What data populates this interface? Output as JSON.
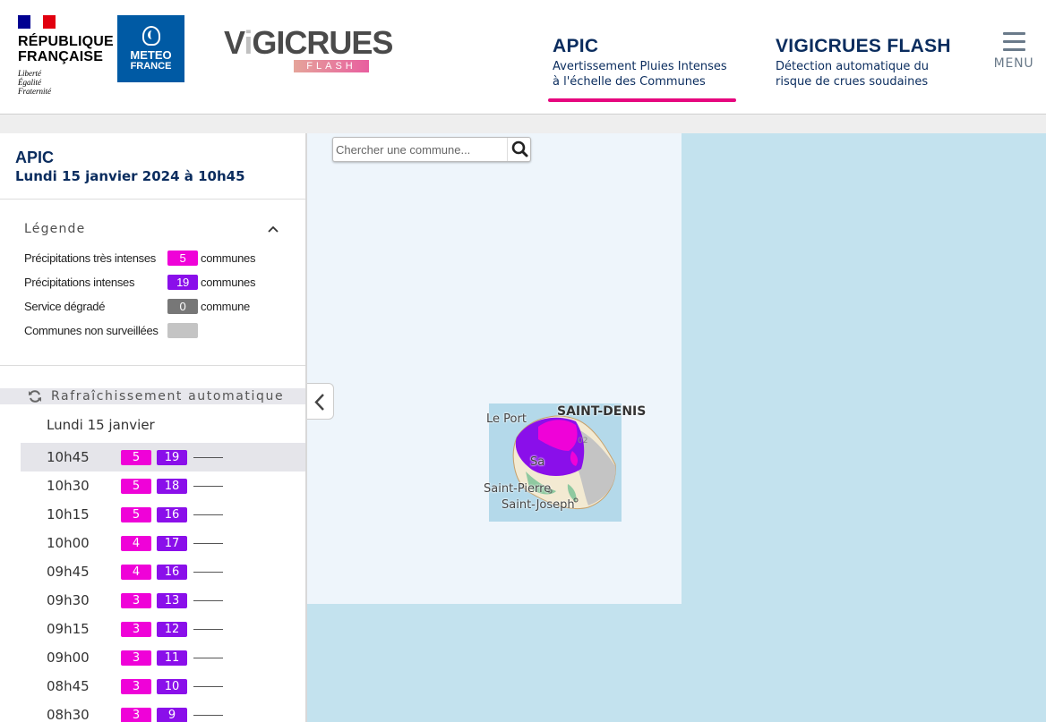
{
  "header": {
    "republique": {
      "title_line1": "RÉPUBLIQUE",
      "title_line2": "FRANÇAISE",
      "motto": [
        "Liberté",
        "Égalité",
        "Fraternité"
      ],
      "flag_colors": [
        "#000091",
        "#ffffff",
        "#e1000f"
      ]
    },
    "meteo_france": {
      "line1": "METEO",
      "line2": "FRANCE",
      "color": "#005aa4"
    },
    "vigicrues": {
      "word_pre": "V",
      "word_i": "i",
      "word_post": "GICRUES",
      "flash": "FLASH"
    },
    "nav": [
      {
        "title": "APIC",
        "subtitle_line1": "Avertissement Pluies Intenses",
        "subtitle_line2": "à l'échelle des Communes",
        "active": true
      },
      {
        "title": "VIGICRUES FLASH",
        "subtitle_line1": "Détection automatique du",
        "subtitle_line2": "risque de crues soudaines",
        "active": false
      }
    ],
    "menu_label": "MENU",
    "accent_color": "#e6077e"
  },
  "sidebar": {
    "title": "APIC",
    "date": "Lundi 15 janvier 2024 à 10h45",
    "legend": {
      "heading": "Légende",
      "rows": [
        {
          "label": "Précipitations très intenses",
          "count": "5",
          "unit": "communes",
          "color": "#ef02d8"
        },
        {
          "label": "Précipitations intenses",
          "count": "19",
          "unit": "communes",
          "color": "#8a0fea"
        },
        {
          "label": "Service dégradé",
          "count": "0",
          "unit": "commune",
          "color": "#777777"
        },
        {
          "label": "Communes non surveillées",
          "count": "",
          "unit": "",
          "color": "#c4c4c4"
        }
      ]
    },
    "refresh_label": "Rafraîchissement automatique",
    "day_label": "Lundi 15 janvier",
    "timeline": [
      {
        "time": "10h45",
        "very_intense": "5",
        "intense": "19",
        "active": true
      },
      {
        "time": "10h30",
        "very_intense": "5",
        "intense": "18"
      },
      {
        "time": "10h15",
        "very_intense": "5",
        "intense": "16"
      },
      {
        "time": "10h00",
        "very_intense": "4",
        "intense": "17"
      },
      {
        "time": "09h45",
        "very_intense": "4",
        "intense": "16"
      },
      {
        "time": "09h30",
        "very_intense": "3",
        "intense": "13"
      },
      {
        "time": "09h15",
        "very_intense": "3",
        "intense": "12"
      },
      {
        "time": "09h00",
        "very_intense": "3",
        "intense": "11"
      },
      {
        "time": "08h45",
        "very_intense": "3",
        "intense": "10"
      },
      {
        "time": "08h30",
        "very_intense": "3",
        "intense": "9"
      }
    ]
  },
  "map": {
    "search_placeholder": "Chercher une commune...",
    "places": {
      "saint_denis": "SAINT-DENIS",
      "le_port": "Le Port",
      "saint_pierre": "Saint-Pierre",
      "saint_joseph": "Saint-Joseph",
      "sa": "Sa"
    },
    "colors": {
      "sea": "#c3e2ee",
      "very_intense": "#ef02d8",
      "intense": "#8a0fea",
      "unmonitored": "#c4c4c4"
    }
  }
}
